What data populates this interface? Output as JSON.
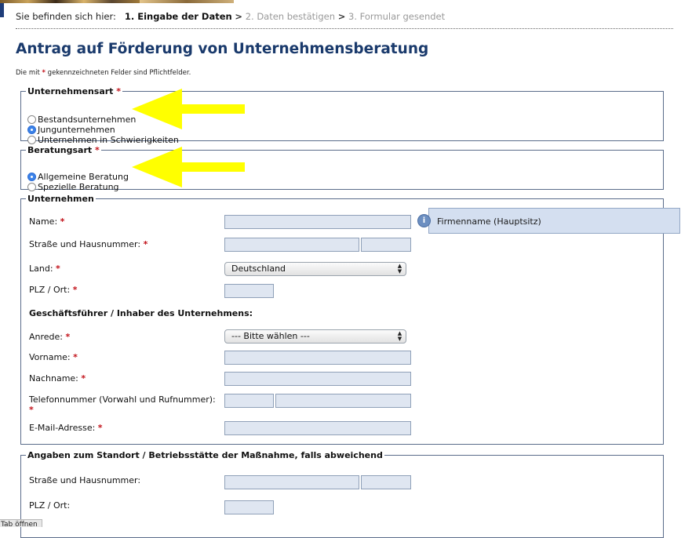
{
  "breadcrumb": {
    "prefix": "Sie befinden sich hier:",
    "step1": "1. Eingabe der Daten",
    "sep1": ">",
    "step2": "2. Daten bestätigen",
    "sep2": ">",
    "step3": "3. Formular gesendet"
  },
  "page_title": "Antrag auf Förderung von Unternehmensberatung",
  "required_note": {
    "before": "Die mit",
    "star": "*",
    "after": "gekennzeichneten Felder sind Pflichtfelder."
  },
  "unternehmensart": {
    "legend": "Unternehmensart",
    "star": "*",
    "options": [
      {
        "label": "Bestandsunternehmen",
        "selected": false
      },
      {
        "label": "Jungunternehmen",
        "selected": true
      },
      {
        "label": "Unternehmen in Schwierigkeiten",
        "selected": false
      }
    ]
  },
  "beratungsart": {
    "legend": "Beratungsart",
    "star": "*",
    "options": [
      {
        "label": "Allgemeine Beratung",
        "selected": true
      },
      {
        "label": "Spezielle Beratung",
        "selected": false
      }
    ]
  },
  "unternehmen": {
    "legend": "Unternehmen",
    "name_label": "Name:",
    "strasse_label": "Straße und Hausnummer:",
    "land_label": "Land:",
    "land_value": "Deutschland",
    "plz_label": "PLZ / Ort:",
    "gf_heading": "Geschäftsführer / Inhaber des Unternehmens:",
    "anrede_label": "Anrede:",
    "anrede_value": "--- Bitte wählen ---",
    "vorname_label": "Vorname:",
    "nachname_label": "Nachname:",
    "telefon_label": "Telefonnummer (Vorwahl und Rufnummer):",
    "email_label": "E-Mail-Adresse:",
    "star": "*"
  },
  "tooltip": {
    "text": "Firmenname (Hauptsitz)",
    "icon": "info-bubble-icon"
  },
  "standort": {
    "legend": "Angaben zum Standort / Betriebsstätte der Maßnahme, falls abweichend",
    "strasse_label": "Straße und Hausnummer:",
    "plz_label": "PLZ / Ort:"
  },
  "status_bar": {
    "text": "Tab öffnen"
  },
  "colors": {
    "title": "#1a3a6c",
    "required": "#c2121a",
    "arrow": "#ffff00",
    "input_bg": "#dfe6f1"
  }
}
